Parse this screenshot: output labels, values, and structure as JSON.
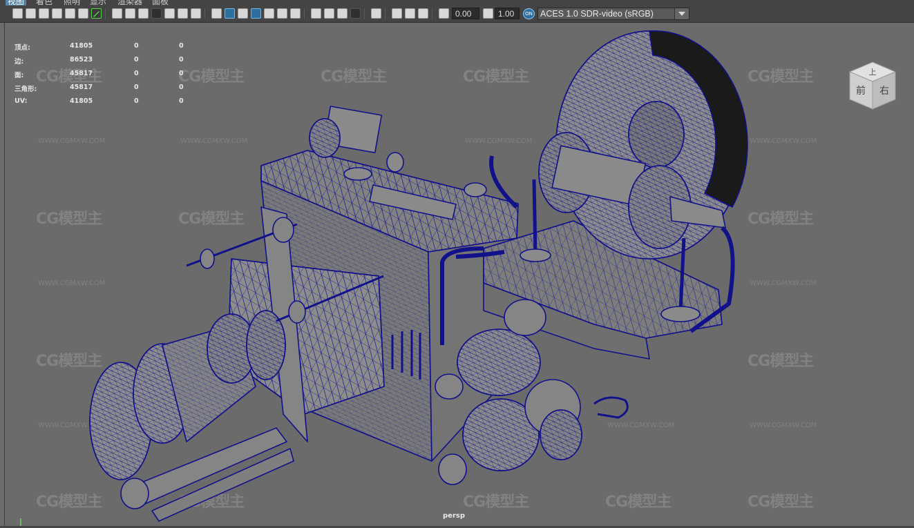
{
  "menu": {
    "items": [
      "视图",
      "着色",
      "照明",
      "显示",
      "渲染器",
      "面板"
    ]
  },
  "toolbar": {
    "exposure_value": "0.00",
    "gamma_value": "1.00",
    "color_space_badge": "ON",
    "color_space": "ACES 1.0 SDR-video (sRGB)"
  },
  "hud": {
    "rows": [
      {
        "label": "顶点:",
        "total": "41805",
        "selected": "0",
        "tris": "0"
      },
      {
        "label": "边:",
        "total": "86523",
        "selected": "0",
        "tris": "0"
      },
      {
        "label": "面:",
        "total": "45817",
        "selected": "0",
        "tris": "0"
      },
      {
        "label": "三角形:",
        "total": "45817",
        "selected": "0",
        "tris": "0"
      },
      {
        "label": "UV:",
        "total": "41805",
        "selected": "0",
        "tris": "0"
      }
    ]
  },
  "viewcube": {
    "top_face": "上",
    "front_face": "前",
    "right_face": "右"
  },
  "camera_label": "persp",
  "watermark": {
    "logo": "CG模型主",
    "url": "WWW.CGMXW.COM"
  },
  "colors": {
    "wire": "#11118a",
    "shade": "#858585",
    "viewport_bg": "#6b6b6b",
    "accent": "#5285a6"
  }
}
